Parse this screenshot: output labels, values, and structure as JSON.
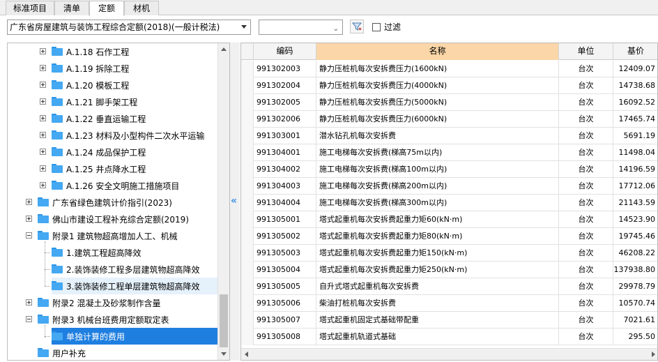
{
  "tabs": [
    {
      "label": "标准项目",
      "active": false
    },
    {
      "label": "清单",
      "active": false
    },
    {
      "label": "定额",
      "active": true
    },
    {
      "label": "材机",
      "active": false
    }
  ],
  "toolbar": {
    "quota_library": "广东省房屋建筑与装饰工程综合定额(2018)(一般计税法)",
    "secondary_select": "",
    "filter_checked": false,
    "filter_label": "过滤"
  },
  "tree": {
    "items": [
      {
        "label": "A.1.18 石作工程",
        "level": 1,
        "expander": "plus",
        "state": "normal"
      },
      {
        "label": "A.1.19 拆除工程",
        "level": 1,
        "expander": "plus",
        "state": "normal"
      },
      {
        "label": "A.1.20 模板工程",
        "level": 1,
        "expander": "plus",
        "state": "normal"
      },
      {
        "label": "A.1.21 脚手架工程",
        "level": 1,
        "expander": "plus",
        "state": "normal"
      },
      {
        "label": "A.1.22 垂直运输工程",
        "level": 1,
        "expander": "plus",
        "state": "normal"
      },
      {
        "label": "A.1.23 材料及小型构件二次水平运输",
        "level": 1,
        "expander": "plus",
        "state": "normal"
      },
      {
        "label": "A.1.24 成品保护工程",
        "level": 1,
        "expander": "plus",
        "state": "normal"
      },
      {
        "label": "A.1.25 井点降水工程",
        "level": 1,
        "expander": "plus",
        "state": "normal"
      },
      {
        "label": "A.1.26 安全文明施工措施项目",
        "level": 1,
        "expander": "plus",
        "state": "normal"
      },
      {
        "label": "广东省绿色建筑计价指引(2023)",
        "level": 0,
        "expander": "plus",
        "state": "normal"
      },
      {
        "label": "佛山市建设工程补充综合定额(2019)",
        "level": 0,
        "expander": "plus",
        "state": "normal"
      },
      {
        "label": "附录1 建筑物超高增加人工、机械",
        "level": 0,
        "expander": "minus",
        "state": "normal"
      },
      {
        "label": "1.建筑工程超高降效",
        "level": 1,
        "expander": "none",
        "state": "normal"
      },
      {
        "label": "2.装饰装修工程多层建筑物超高降效",
        "level": 1,
        "expander": "none",
        "state": "normal"
      },
      {
        "label": "3.装饰装修工程单层建筑物超高降效",
        "level": 1,
        "expander": "none",
        "state": "hover"
      },
      {
        "label": "附录2 混凝土及砂浆制作含量",
        "level": 0,
        "expander": "plus",
        "state": "normal"
      },
      {
        "label": "附录3 机械台班费用定额取定表",
        "level": 0,
        "expander": "minus",
        "state": "normal"
      },
      {
        "label": "单独计算的费用",
        "level": 1,
        "expander": "none",
        "state": "selected"
      },
      {
        "label": "用户补充",
        "level": 0,
        "expander": "none",
        "state": "normal"
      }
    ]
  },
  "grid": {
    "headers": {
      "code": "编码",
      "name": "名称",
      "unit": "单位",
      "price": "基价"
    },
    "rows": [
      {
        "code": "991302003",
        "name": "静力压桩机每次安拆费压力(1600kN)",
        "unit": "台次",
        "price": "12409.07"
      },
      {
        "code": "991302004",
        "name": "静力压桩机每次安拆费压力(4000kN)",
        "unit": "台次",
        "price": "14738.68"
      },
      {
        "code": "991302005",
        "name": "静力压桩机每次安拆费压力(5000kN)",
        "unit": "台次",
        "price": "16092.52"
      },
      {
        "code": "991302006",
        "name": "静力压桩机每次安拆费压力(6000kN)",
        "unit": "台次",
        "price": "17465.74"
      },
      {
        "code": "991303001",
        "name": "潜水钻孔机每次安拆费",
        "unit": "台次",
        "price": "5691.19"
      },
      {
        "code": "991304001",
        "name": "施工电梯每次安拆费(梯高75m以内)",
        "unit": "台次",
        "price": "11498.04"
      },
      {
        "code": "991304002",
        "name": "施工电梯每次安拆费(梯高100m以内)",
        "unit": "台次",
        "price": "14196.59"
      },
      {
        "code": "991304003",
        "name": "施工电梯每次安拆费(梯高200m以内)",
        "unit": "台次",
        "price": "17712.06"
      },
      {
        "code": "991304004",
        "name": "施工电梯每次安拆费(梯高300m以内)",
        "unit": "台次",
        "price": "21143.59"
      },
      {
        "code": "991305001",
        "name": "塔式起重机每次安拆费起重力矩60(kN·m)",
        "unit": "台次",
        "price": "14523.90"
      },
      {
        "code": "991305002",
        "name": "塔式起重机每次安拆费起重力矩80(kN·m)",
        "unit": "台次",
        "price": "19745.46"
      },
      {
        "code": "991305003",
        "name": "塔式起重机每次安拆费起重力矩150(kN·m)",
        "unit": "台次",
        "price": "46208.22"
      },
      {
        "code": "991305004",
        "name": "塔式起重机每次安拆费起重力矩250(kN·m)",
        "unit": "台次",
        "price": "137938.80"
      },
      {
        "code": "991305005",
        "name": "自升式塔式起重机每次安拆费",
        "unit": "台次",
        "price": "29978.79"
      },
      {
        "code": "991305006",
        "name": "柴油打桩机每次安拆费",
        "unit": "台次",
        "price": "10570.74"
      },
      {
        "code": "991305007",
        "name": "塔式起重机固定式基础带配重",
        "unit": "台次",
        "price": "7021.61"
      },
      {
        "code": "991305008",
        "name": "塔式起重机轨道式基础",
        "unit": "台次",
        "price": "295.50"
      }
    ]
  },
  "colors": {
    "selected": "#1f7fe0",
    "sorted_header": "#fbd6a8",
    "folder": "#44a8f2"
  }
}
